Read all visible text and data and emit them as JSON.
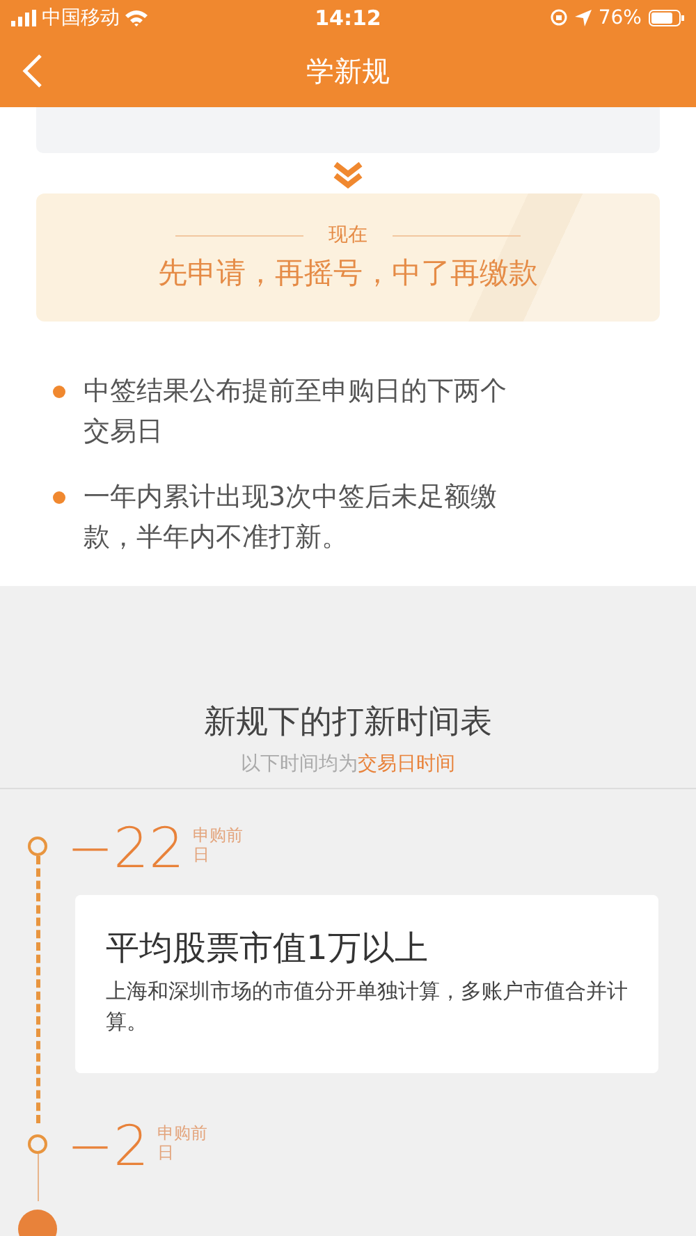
{
  "status_bar": {
    "carrier": "中国移动",
    "time": "14:12",
    "battery": "76%"
  },
  "nav": {
    "title": "学新规"
  },
  "now_card": {
    "label": "现在",
    "text": "先申请，再摇号，中了再缴款"
  },
  "bullets": [
    "中签结果公布提前至申购日的下两个交易日",
    "一年内累计出现3次中签后未足额缴款，半年内不准打新。"
  ],
  "schedule": {
    "title": "新规下的打新时间表",
    "subtitle": "以下时间均为**交易日时间**",
    "items": [
      {
        "kind": "offset",
        "current": false,
        "line_dashed": true,
        "number": "−22",
        "unit": "申购前日",
        "card": {
          "title": "平均股票市值1万以上",
          "text": "上海和深圳市场的市值分开单独计算，多账户市值合并计算。"
        }
      },
      {
        "kind": "offset",
        "current": false,
        "line_dashed": false,
        "number": "−2",
        "unit": "申购前日"
      },
      {
        "kind": "day",
        "current": true
      }
    ]
  }
}
